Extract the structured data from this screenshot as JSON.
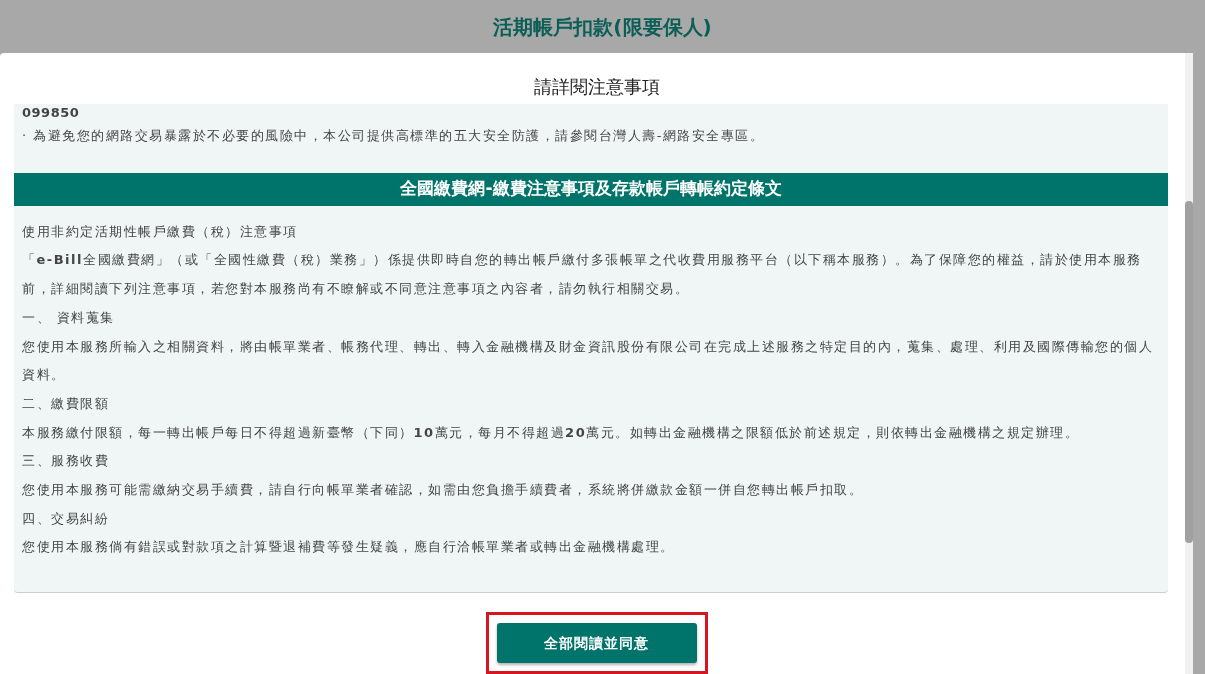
{
  "page_title": "活期帳戶扣款(限要保人)",
  "dialog": {
    "title": "請詳閱注意事項",
    "notice_lines": [
      {
        "kind": "strong",
        "text": "099850"
      },
      {
        "kind": "text",
        "text": "· 為避免您的網路交易暴露於不必要的風險中，本公司提供高標準的五大安全防護，請參閱台灣人壽-網路安全專區。"
      }
    ],
    "section_heading": "全國繳費網-繳費注意事項及存款帳戶轉帳約定條文",
    "paragraphs": [
      "使用非約定活期性帳戶繳費（稅）注意事項",
      "「**e-Bill**全國繳費網」（或「全國性繳費（稅）業務」）係提供即時自您的轉出帳戶繳付多張帳單之代收費用服務平台（以下稱本服務）。為了保障您的權益，請於使用本服務前，詳細閱讀下列注意事項，若您對本服務尚有不瞭解或不同意注意事項之內容者，請勿執行相關交易。",
      "一、 資料蒐集",
      "您使用本服務所輸入之相關資料，將由帳單業者、帳務代理、轉出、轉入金融機構及財金資訊股份有限公司在完成上述服務之特定目的內，蒐集、處理、利用及國際傳輸您的個人資料。",
      "二、繳費限額",
      "本服務繳付限額，每一轉出帳戶每日不得超過新臺幣（下同）**10**萬元，每月不得超過**20**萬元。如轉出金融機構之限額低於前述規定，則依轉出金融機構之規定辦理。",
      "三、服務收費",
      "您使用本服務可能需繳納交易手續費，請自行向帳單業者確認，如需由您負擔手續費者，系統將併繳款金額一併自您轉出帳戶扣取。",
      "四、交易糾紛",
      "您使用本服務倘有錯誤或對款項之計算暨退補費等發生疑義，應自行洽帳單業者或轉出金融機構處理。"
    ],
    "confirm_button": {
      "label": "全部閱讀並同意",
      "highlighted": true
    }
  }
}
